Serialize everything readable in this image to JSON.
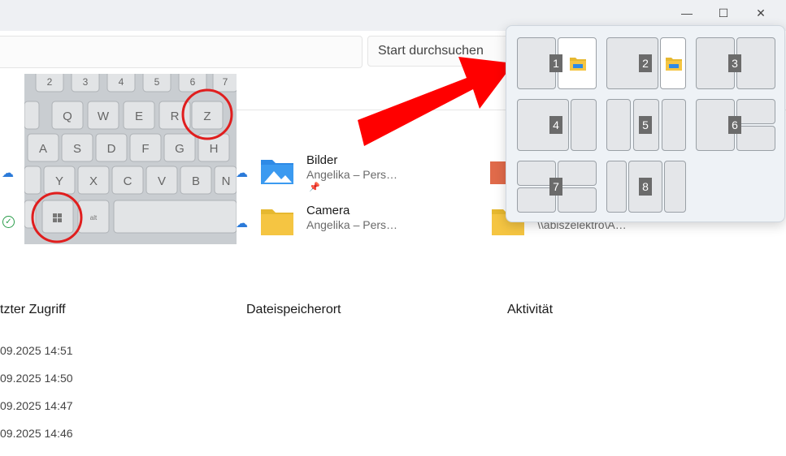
{
  "window": {
    "controls": {
      "minimize": "—",
      "maximize": "☐",
      "close": "✕"
    }
  },
  "search": {
    "placeholder": "Start durchsuchen"
  },
  "keyboard_photo": {
    "keys_row1": [
      "2",
      "3",
      "4",
      "5",
      "6",
      "7"
    ],
    "keys_row2": [
      "Q",
      "W",
      "E",
      "R",
      "T",
      "Z"
    ],
    "keys_row3": [
      "A",
      "S",
      "D",
      "F",
      "G",
      "H"
    ],
    "keys_row4": [
      "Y",
      "X",
      "C",
      "V",
      "B",
      "N"
    ],
    "alt_label": "alt"
  },
  "files": [
    {
      "name": "Bilder",
      "location": "Angelika – Pers…"
    },
    {
      "name": "Camera",
      "location": "Angelika – Pers…"
    }
  ],
  "partial_path": "\\\\abiszelektro\\A…",
  "columns": {
    "last_access": "tzter Zugriff",
    "location": "Dateispeicherort",
    "activity": "Aktivität"
  },
  "dates": [
    "09.2025 14:51",
    "09.2025 14:50",
    "09.2025 14:47",
    "09.2025 14:46"
  ],
  "snap_layouts": [
    "1",
    "2",
    "3",
    "4",
    "5",
    "6",
    "7",
    "8"
  ],
  "colors": {
    "accent_arrow": "#ff0000",
    "circle": "#e01e1e",
    "folder_yellow": "#f5c542"
  }
}
